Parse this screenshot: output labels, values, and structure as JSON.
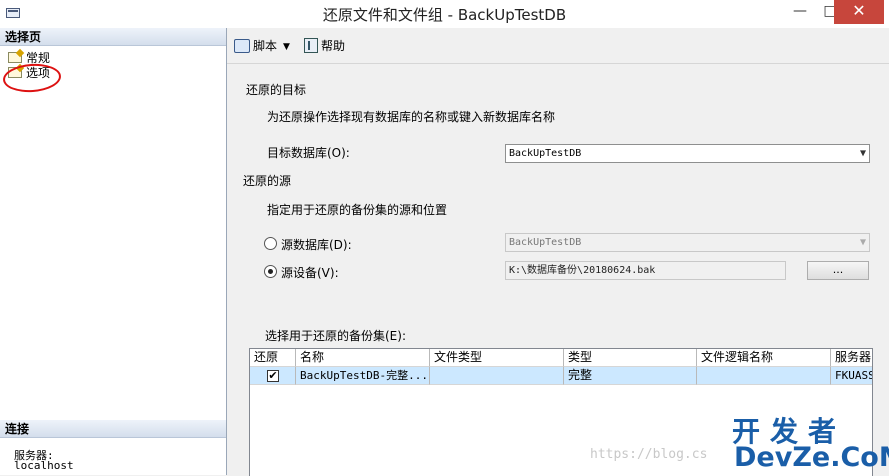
{
  "window": {
    "title": "还原文件和文件组 - BackUpTestDB",
    "minimize": "—",
    "maximize": "□",
    "close": "✕"
  },
  "left_panel": {
    "select_page_header": "选择页",
    "pages": [
      {
        "label": "常规",
        "icon": "page-icon"
      },
      {
        "label": "选项",
        "icon": "page-icon"
      }
    ],
    "connection_header": "连接",
    "server_label": "服务器:",
    "server_value": "localhost"
  },
  "toolbar": {
    "script_label": "脚本",
    "help_label": "帮助"
  },
  "restore_target": {
    "heading": "还原的目标",
    "instruction": "为还原操作选择现有数据库的名称或键入新数据库名称",
    "target_db_label": "目标数据库(O):",
    "target_db_value": "BackUpTestDB"
  },
  "restore_source": {
    "heading": "还原的源",
    "instruction": "指定用于还原的备份集的源和位置",
    "source_db_label": "源数据库(D):",
    "source_db_value": "BackUpTestDB",
    "source_device_label": "源设备(V):",
    "source_device_value": "K:\\数据库备份\\20180624.bak",
    "browse_button": "...",
    "selected_option": "源设备"
  },
  "backup_sets": {
    "label": "选择用于还原的备份集(E):",
    "columns": [
      "还原",
      "名称",
      "文件类型",
      "类型",
      "文件逻辑名称",
      "服务器"
    ],
    "rows": [
      {
        "restore_checked": true,
        "check_mark": "✔",
        "name": "BackUpTestDB-完整...",
        "file_type": "",
        "type": "完整",
        "logical_name": "",
        "server": "FKUASS"
      }
    ]
  },
  "watermark": {
    "cn": "开发者",
    "en": "DevZe.CoM",
    "blog": "https://blog.cs"
  }
}
